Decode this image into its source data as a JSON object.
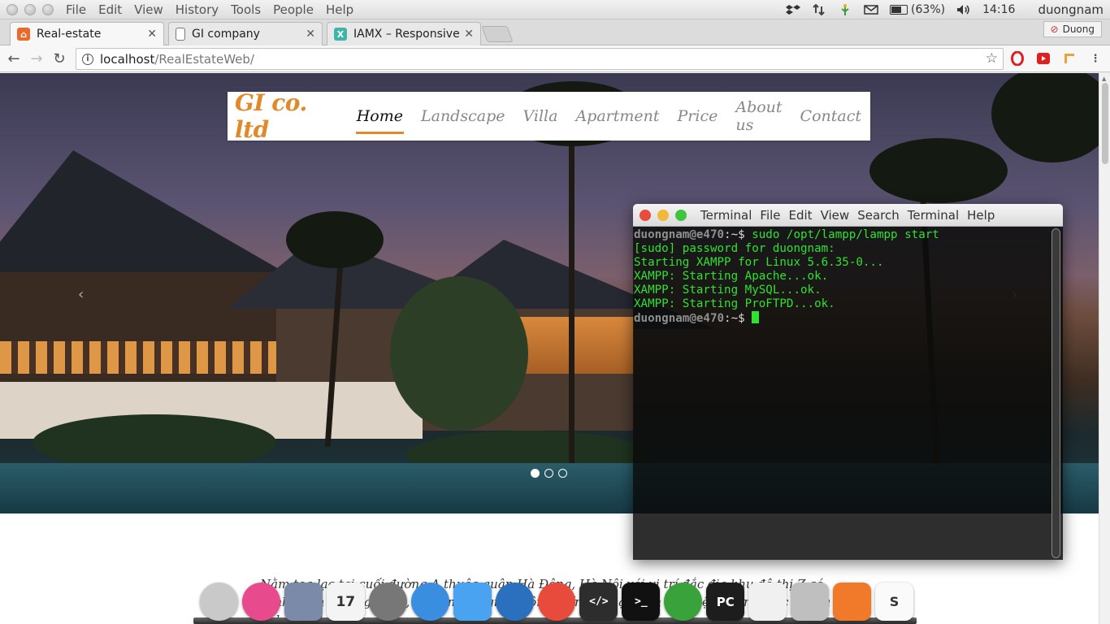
{
  "menubar": {
    "menus": [
      "File",
      "Edit",
      "View",
      "History",
      "Tools",
      "People",
      "Help"
    ],
    "battery": "(63%)",
    "time": "14:16",
    "user": "duongnam"
  },
  "tabs": [
    {
      "title": "Real-estate",
      "icon": "house-icon",
      "active": true
    },
    {
      "title": "GI company",
      "icon": "page-icon",
      "active": false
    },
    {
      "title": "IAMX – Responsive",
      "icon": "x-icon",
      "active": false
    }
  ],
  "profile": "Duong",
  "omnibox": {
    "host": "localhost",
    "path": "/RealEstateWeb/"
  },
  "site": {
    "brand": "GI co. ltd",
    "nav": [
      "Home",
      "Landscape",
      "Villa",
      "Apartment",
      "Price",
      "About us",
      "Contact"
    ],
    "intro": "Nằm tọa lạc tại cuối đường A thuộc quận Hà Đông, Hà Nội với vị trí đắc địa khu đô thị Z có cảnh quan thoáng đãng, kề bên khu giao thông chính, thuận tiện cho việc kết nối học tập và nghỉ mát tại đây"
  },
  "terminal": {
    "menu": [
      "Terminal",
      "File",
      "Edit",
      "View",
      "Search",
      "Terminal",
      "Help"
    ],
    "user_host": "duongnam@e470",
    "prompt": ":~$ ",
    "command": "sudo /opt/lampp/lampp start",
    "output": [
      "[sudo] password for duongnam:",
      "Starting XAMPP for Linux 5.6.35-0...",
      "XAMPP: Starting Apache...ok.",
      "XAMPP: Starting MySQL...ok.",
      "XAMPP: Starting ProFTPD...ok."
    ]
  },
  "dock": [
    {
      "name": "launchpad-icon",
      "color": "#c9c9c9"
    },
    {
      "name": "itunes-icon",
      "color": "#e84a8e"
    },
    {
      "name": "files-icon",
      "color": "#7a8aa8"
    },
    {
      "name": "calendar-icon",
      "color": "#f4f4f4",
      "label": "17"
    },
    {
      "name": "settings-icon",
      "color": "#777777"
    },
    {
      "name": "browser-icon",
      "color": "#3a8ee0"
    },
    {
      "name": "finder-icon",
      "color": "#4aa3f0"
    },
    {
      "name": "quicktime-icon",
      "color": "#2b6fbf"
    },
    {
      "name": "chrome-icon",
      "color": "#e84a3c"
    },
    {
      "name": "code-editor-icon",
      "color": "#2d2d2d",
      "label": "</>"
    },
    {
      "name": "terminal-icon",
      "color": "#111111",
      "label": ">_"
    },
    {
      "name": "green-app-icon",
      "color": "#3aa23a"
    },
    {
      "name": "pycharm-icon",
      "color": "#1d1d1d",
      "label": "PC"
    },
    {
      "name": "notes-icon",
      "color": "#f0f0f0"
    },
    {
      "name": "trash-icon",
      "color": "#bfbfbf"
    },
    {
      "name": "xampp-icon",
      "color": "#f07a2a"
    },
    {
      "name": "slack-icon",
      "color": "#fafafa",
      "label": "S"
    }
  ]
}
